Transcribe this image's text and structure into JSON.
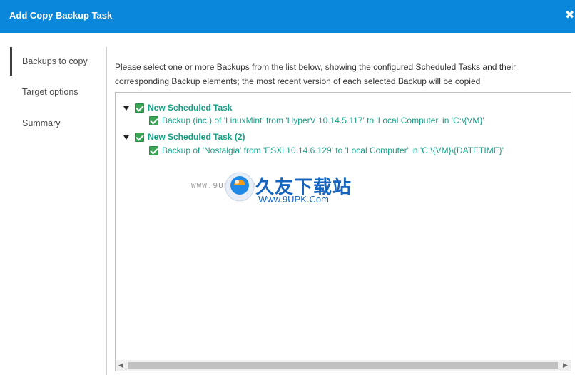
{
  "window": {
    "title": "Add Copy Backup Task",
    "close_glyph": "✖"
  },
  "nav": {
    "items": [
      {
        "label": "Backups to copy",
        "active": true
      },
      {
        "label": "Target options",
        "active": false
      },
      {
        "label": "Summary",
        "active": false
      }
    ]
  },
  "main": {
    "instructions": "Please select one or more Backups from the list below, showing the configured Scheduled Tasks and their corresponding Backup elements; the most recent version of each selected Backup will be copied",
    "tree": [
      {
        "label": "New Scheduled Task",
        "checked": true,
        "expanded": true,
        "children": [
          {
            "label": "Backup (inc.) of 'LinuxMint' from 'HyperV 10.14.5.117' to 'Local Computer' in 'C:\\{VM}'",
            "checked": true
          }
        ]
      },
      {
        "label": "New Scheduled Task (2)",
        "checked": true,
        "expanded": true,
        "children": [
          {
            "label": "Backup of 'Nostalgia' from 'ESXi 10.14.6.129' to 'Local Computer' in 'C:\\{VM}\\{DATETIME}'",
            "checked": true
          }
        ]
      }
    ],
    "scrollbar": {
      "left_arrow": "◀",
      "right_arrow": "▶"
    }
  },
  "watermark": {
    "www": "WWW.9UPK.COM",
    "cn": "久友下载站",
    "url": "Www.9UPK.Com"
  },
  "colors": {
    "titlebar": "#0a86db",
    "tree_text": "#16a085",
    "checkbox": "#3aa655"
  }
}
